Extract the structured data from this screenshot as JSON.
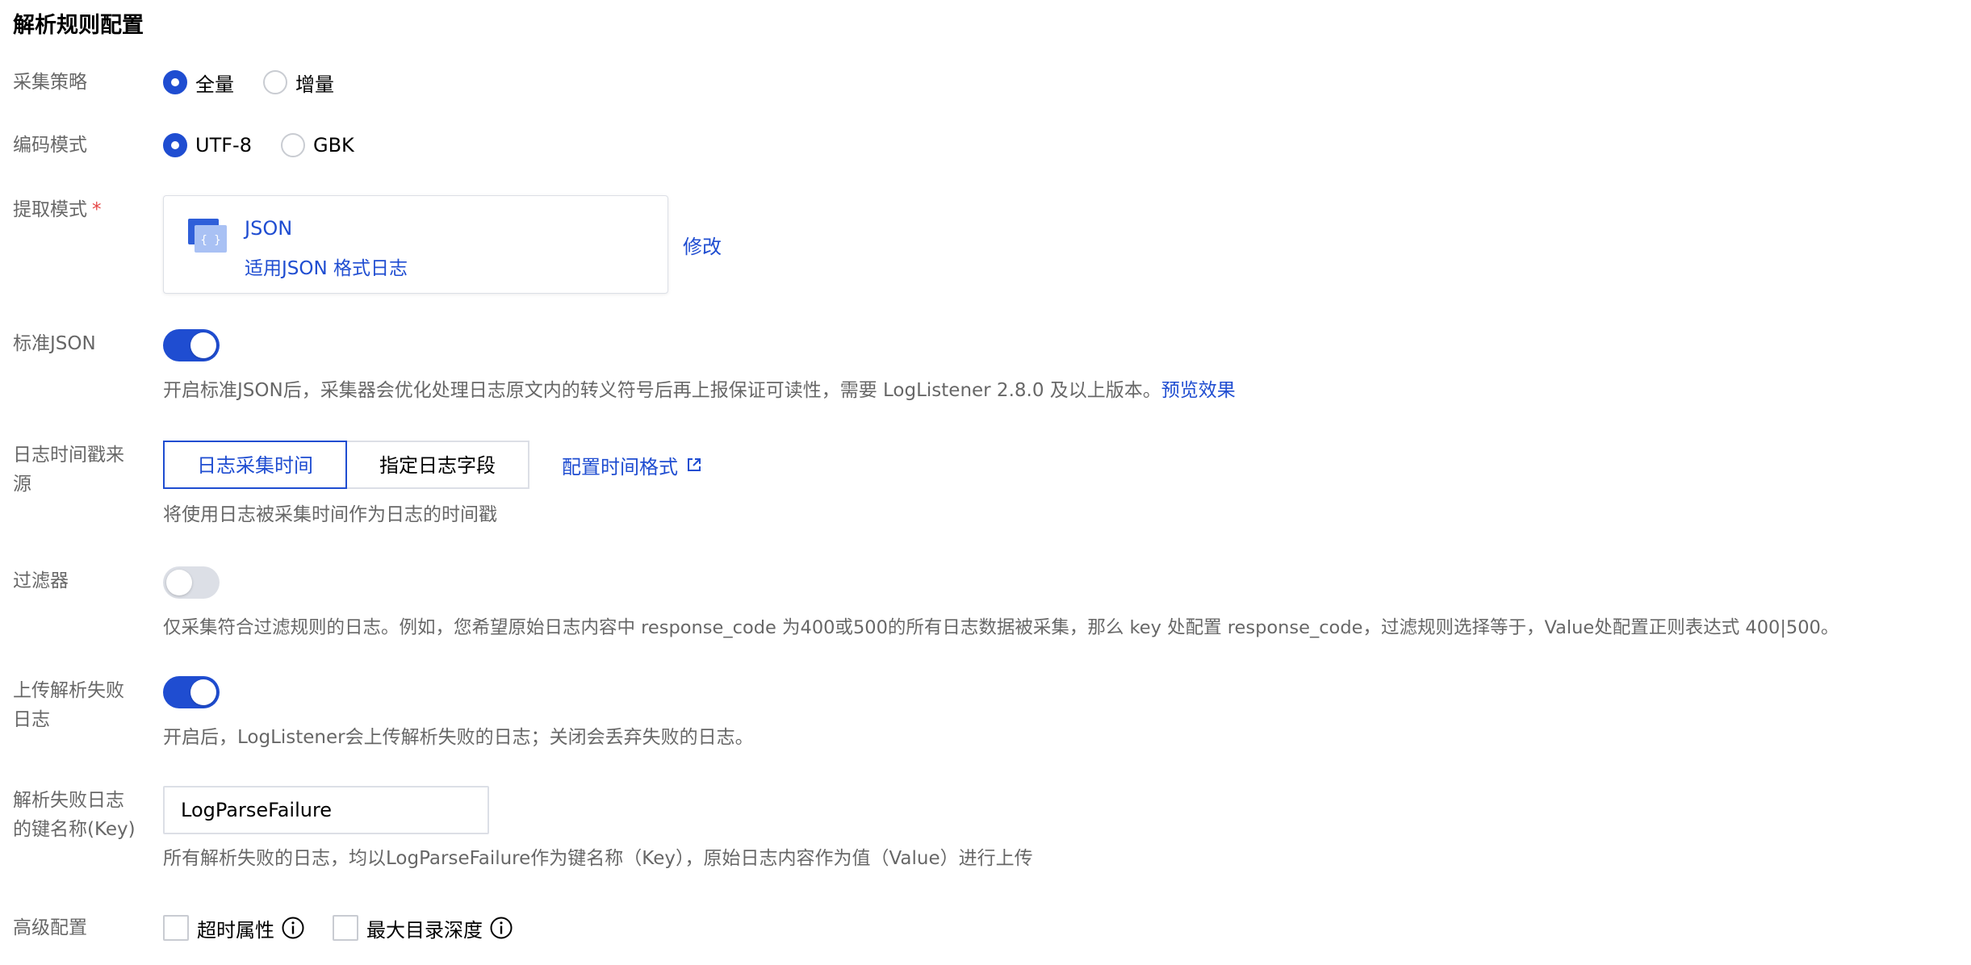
{
  "title": "解析规则配置",
  "collect_strategy": {
    "label": "采集策略",
    "options": [
      "全量",
      "增量"
    ],
    "selected": 0
  },
  "encoding": {
    "label": "编码模式",
    "options": [
      "UTF-8",
      "GBK"
    ],
    "selected": 0
  },
  "extract_mode": {
    "label": "提取模式",
    "required_mark": "*",
    "name": "JSON",
    "desc": "适用JSON 格式日志",
    "modify": "修改"
  },
  "standard_json": {
    "label": "标准JSON",
    "on": true,
    "help": "开启标准JSON后，采集器会优化处理日志原文内的转义符号后再上报保证可读性，需要 LogListener 2.8.0 及以上版本。",
    "help_link": "预览效果"
  },
  "timestamp_source": {
    "label": "日志时间戳来源",
    "options": [
      "日志采集时间",
      "指定日志字段"
    ],
    "selected": 0,
    "link": "配置时间格式",
    "help": "将使用日志被采集时间作为日志的时间戳"
  },
  "filter": {
    "label": "过滤器",
    "on": false,
    "help": "仅采集符合过滤规则的日志。例如，您希望原始日志内容中 response_code 为400或500的所有日志数据被采集，那么 key 处配置 response_code，过滤规则选择等于，Value处配置正则表达式 400|500。"
  },
  "upload_failure": {
    "label": "上传解析失败日志",
    "on": true,
    "help": "开启后，LogListener会上传解析失败的日志；关闭会丢弃失败的日志。"
  },
  "failure_key": {
    "label": "解析失败日志的键名称(Key)",
    "value": "LogParseFailure",
    "help": "所有解析失败的日志，均以LogParseFailure作为键名称（Key），原始日志内容作为值（Value）进行上传"
  },
  "advanced": {
    "label": "高级配置",
    "options": [
      "超时属性",
      "最大目录深度"
    ]
  },
  "colors": {
    "primary": "#1f4dd1",
    "required": "#e54545",
    "border": "#dcdfe6"
  }
}
